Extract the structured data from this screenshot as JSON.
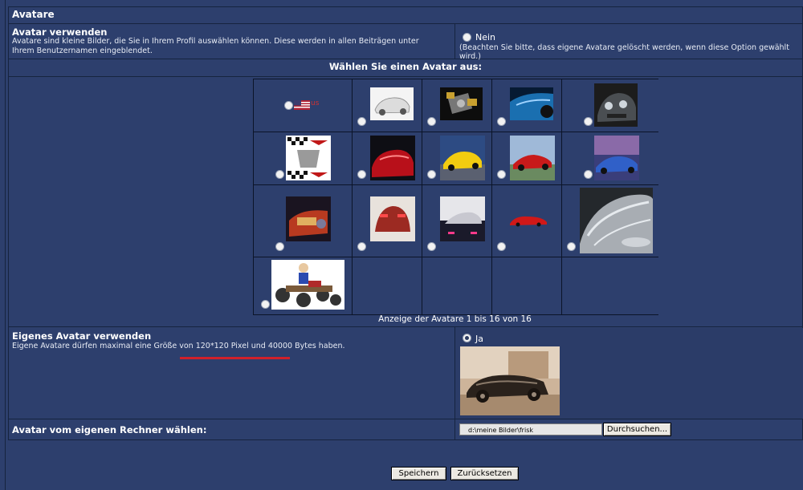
{
  "section_title": "Avatare",
  "use_avatar": {
    "title": "Avatar verwenden",
    "description": "Avatare sind kleine Bilder, die Sie in Ihrem Profil auswählen können. Diese werden in allen Beiträgen unter Ihrem Benutzernamen eingeblendet.",
    "option_label": "Nein",
    "option_note": "(Beachten Sie bitte, dass eigene Avatare gelöscht werden, wenn diese Option gewählt wird.)"
  },
  "choose_heading": "Wählen Sie einen Avatar aus:",
  "avatars": [
    {
      "name": "us-flag",
      "label": "us"
    },
    {
      "name": "white-corvette"
    },
    {
      "name": "corvette-engine"
    },
    {
      "name": "blue-corvette-closeup"
    },
    {
      "name": "dark-corvette-front"
    },
    {
      "name": "corvette-flags-logo"
    },
    {
      "name": "red-corvette"
    },
    {
      "name": "yellow-corvette"
    },
    {
      "name": "red-sports-car"
    },
    {
      "name": "blue-stingray"
    },
    {
      "name": "corvette-dashboard"
    },
    {
      "name": "red-corvette-rear"
    },
    {
      "name": "corvette-night"
    },
    {
      "name": "small-red-car"
    },
    {
      "name": "silver-corvette-fender"
    },
    {
      "name": "cartoon-chassis"
    }
  ],
  "avatar_counter": "Anzeige der Avatare 1 bis 16 von 16",
  "own_avatar": {
    "title": "Eigenes Avatar verwenden",
    "description": "Eigene Avatare dürfen maximal eine Größe von 120*120 Pixel und 40000 Bytes haben.",
    "option_label": "Ja"
  },
  "upload": {
    "title": "Avatar vom eigenen Rechner wählen:",
    "file_value": "d:\\meine Bilder\\frisk",
    "browse_label": "Durchsuchen..."
  },
  "buttons": {
    "save": "Speichern",
    "reset": "Zurücksetzen"
  }
}
